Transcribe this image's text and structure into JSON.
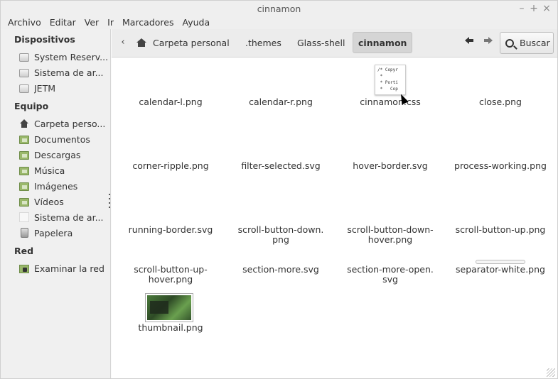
{
  "window": {
    "title": "cinnamon"
  },
  "menubar": [
    "Archivo",
    "Editar",
    "Ver",
    "Ir",
    "Marcadores",
    "Ayuda"
  ],
  "sidebar": {
    "sections": [
      {
        "title": "Dispositivos",
        "items": [
          {
            "label": "System Reserv...",
            "icon": "drive-icon"
          },
          {
            "label": "Sistema de ar...",
            "icon": "drive-icon"
          },
          {
            "label": "JETM",
            "icon": "drive-icon"
          }
        ]
      },
      {
        "title": "Equipo",
        "items": [
          {
            "label": "Carpeta perso...",
            "icon": "home-icon"
          },
          {
            "label": "Documentos",
            "icon": "folder-icon"
          },
          {
            "label": "Descargas",
            "icon": "folder-icon"
          },
          {
            "label": "Música",
            "icon": "folder-icon"
          },
          {
            "label": "Imágenes",
            "icon": "folder-icon"
          },
          {
            "label": "Vídeos",
            "icon": "folder-icon"
          },
          {
            "label": "Sistema de ar...",
            "icon": "file-icon"
          },
          {
            "label": "Papelera",
            "icon": "trash-icon"
          }
        ]
      },
      {
        "title": "Red",
        "items": [
          {
            "label": "Examinar la red",
            "icon": "network-icon"
          }
        ]
      }
    ]
  },
  "toolbar": {
    "breadcrumbs": [
      "Carpeta personal",
      ".themes",
      "Glass-shell",
      "cinnamon"
    ],
    "search_label": "Buscar"
  },
  "files": [
    {
      "name": "calendar-l.png"
    },
    {
      "name": "calendar-r.png"
    },
    {
      "name": "cinnamon.css",
      "preview": "/* Copyr\n *\n * Porti\n *   Cop"
    },
    {
      "name": "close.png"
    },
    {
      "name": "corner-ripple.png"
    },
    {
      "name": "filter-selected.svg"
    },
    {
      "name": "hover-border.svg"
    },
    {
      "name": "process-working.png"
    },
    {
      "name": "running-border.svg"
    },
    {
      "name": "scroll-button-down.png",
      "line1": "scroll-button-down.",
      "line2": "png"
    },
    {
      "name": "scroll-button-down-hover.png",
      "line1": "scroll-button-down-",
      "line2": "hover.png"
    },
    {
      "name": "scroll-button-up.png"
    },
    {
      "name": "scroll-button-up-hover.png",
      "line1": "scroll-button-up-",
      "line2": "hover.png"
    },
    {
      "name": "section-more.svg"
    },
    {
      "name": "section-more-open.svg",
      "line1": "section-more-open.",
      "line2": "svg"
    },
    {
      "name": "separator-white.png"
    },
    {
      "name": "thumbnail.png"
    }
  ]
}
